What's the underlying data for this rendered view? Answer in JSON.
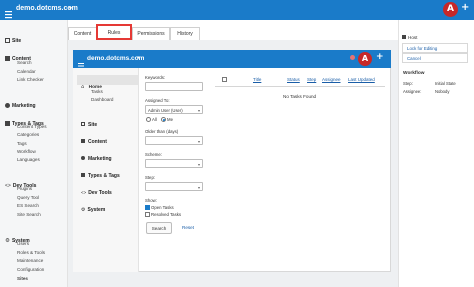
{
  "app": {
    "site_name": "demo.dotcms.com",
    "avatar_letter": "A"
  },
  "sidebar": {
    "sections": [
      {
        "label": "Site",
        "items": []
      },
      {
        "label": "Content",
        "items": [
          "Search",
          "Calendar",
          "Link Checker"
        ]
      },
      {
        "label": "Marketing",
        "items": []
      },
      {
        "label": "Types & Tags",
        "items": [
          "Content Types",
          "Categories",
          "Tags",
          "Workflow",
          "Languages"
        ]
      },
      {
        "label": "Dev Tools",
        "items": [
          "Plugins",
          "Query Tool",
          "ES Search",
          "Site Search"
        ]
      },
      {
        "label": "System",
        "items": [
          "Users",
          "Roles & Tools",
          "Maintenance",
          "Configuration",
          "Sites"
        ]
      }
    ]
  },
  "tabs": [
    "Content",
    "Rules",
    "Permissions",
    "History"
  ],
  "inner": {
    "site_name": "demo.dotcms.com",
    "avatar_letter": "A",
    "nav": [
      {
        "label": "Home",
        "items": [
          "Tasks",
          "Dashboard"
        ]
      },
      {
        "label": "Site",
        "items": []
      },
      {
        "label": "Content",
        "items": []
      },
      {
        "label": "Marketing",
        "items": []
      },
      {
        "label": "Types & Tags",
        "items": []
      },
      {
        "label": "Dev Tools",
        "items": []
      },
      {
        "label": "System",
        "items": []
      }
    ],
    "filter": {
      "keywords_label": "Keywords:",
      "assigned_label": "Assigned To:",
      "assigned_value": "Admin User (User)",
      "all_label": "All",
      "me_label": "Me",
      "older_label": "Older than (days)",
      "scheme_label": "Scheme:",
      "step_label": "Step:",
      "show_label": "Show:",
      "open_tasks": "Open Tasks",
      "resolved_tasks": "Resolved Tasks",
      "search_button": "Search",
      "reset_link": "Reset"
    },
    "table": {
      "columns": [
        "Title",
        "Status",
        "Step",
        "Assignee",
        "Last Updated"
      ],
      "empty": "No Tasks Found"
    }
  },
  "right_panel": {
    "host_label": "Host",
    "links": [
      "Lock for Editing",
      "Cancel"
    ],
    "workflow_heading": "Workflow",
    "rows": [
      {
        "key": "Step:",
        "value": "Initial State"
      },
      {
        "key": "Assignee:",
        "value": "Nobody"
      }
    ]
  },
  "colors": {
    "brand_blue": "#1a7bc9",
    "highlight_red": "#e53935",
    "avatar_red": "#c62828"
  }
}
